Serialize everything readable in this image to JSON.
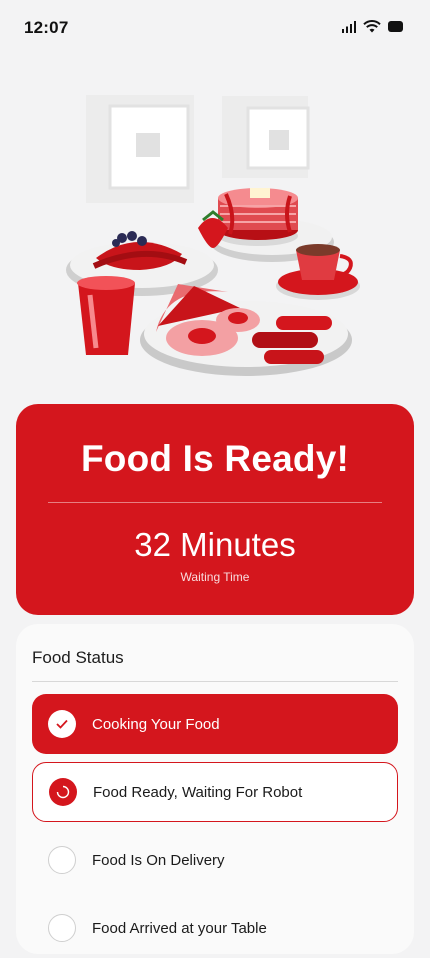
{
  "status_bar": {
    "time": "12:07"
  },
  "ready": {
    "title": "Food Is Ready!",
    "minutes": "32 Minutes",
    "caption": "Waiting Time"
  },
  "food_status": {
    "title": "Food Status",
    "steps": [
      {
        "label": "Cooking Your Food",
        "state": "done"
      },
      {
        "label": "Food Ready, Waiting For Robot",
        "state": "active"
      },
      {
        "label": "Food Is On Delivery",
        "state": "pending"
      },
      {
        "label": "Food Arrived at your Table",
        "state": "pending"
      }
    ]
  },
  "colors": {
    "accent": "#d4161d",
    "background": "#f3f3f4"
  }
}
